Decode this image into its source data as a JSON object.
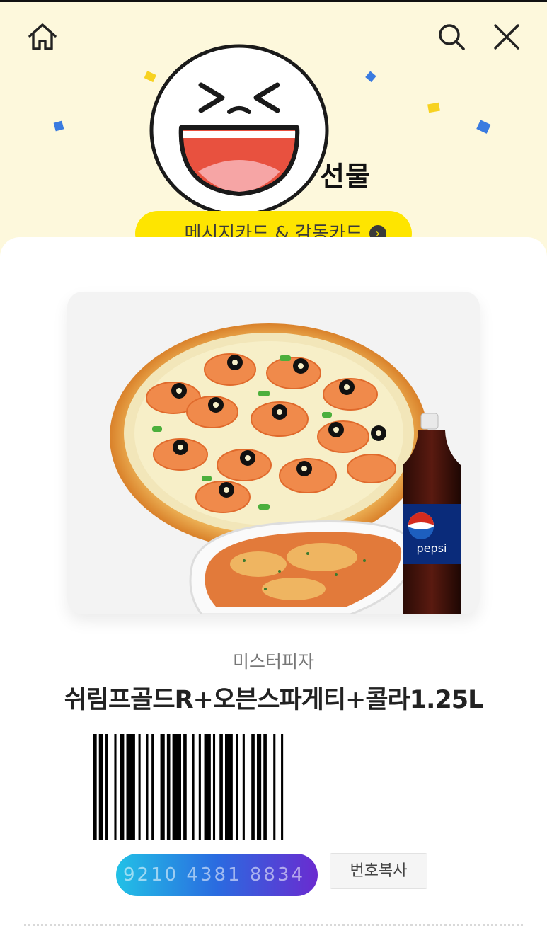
{
  "header": {
    "gift_title": "선물",
    "message_card_label": "메시지카드 & 감동카드",
    "icons": [
      "home-icon",
      "search-icon",
      "close-icon"
    ]
  },
  "product": {
    "brand": "미스터피자",
    "name": "쉬림프골드R+오븐스파게티+콜라1.25L",
    "image_desc": "pizza-spaghetti-cola-set"
  },
  "barcode": {
    "number": "9210 4381 8834",
    "copy_label": "번호복사"
  },
  "colors": {
    "background": "#fdf8dc",
    "accent_yellow": "#fee500",
    "gradient_start": "#22c1e6",
    "gradient_end": "#6a2bd0"
  }
}
